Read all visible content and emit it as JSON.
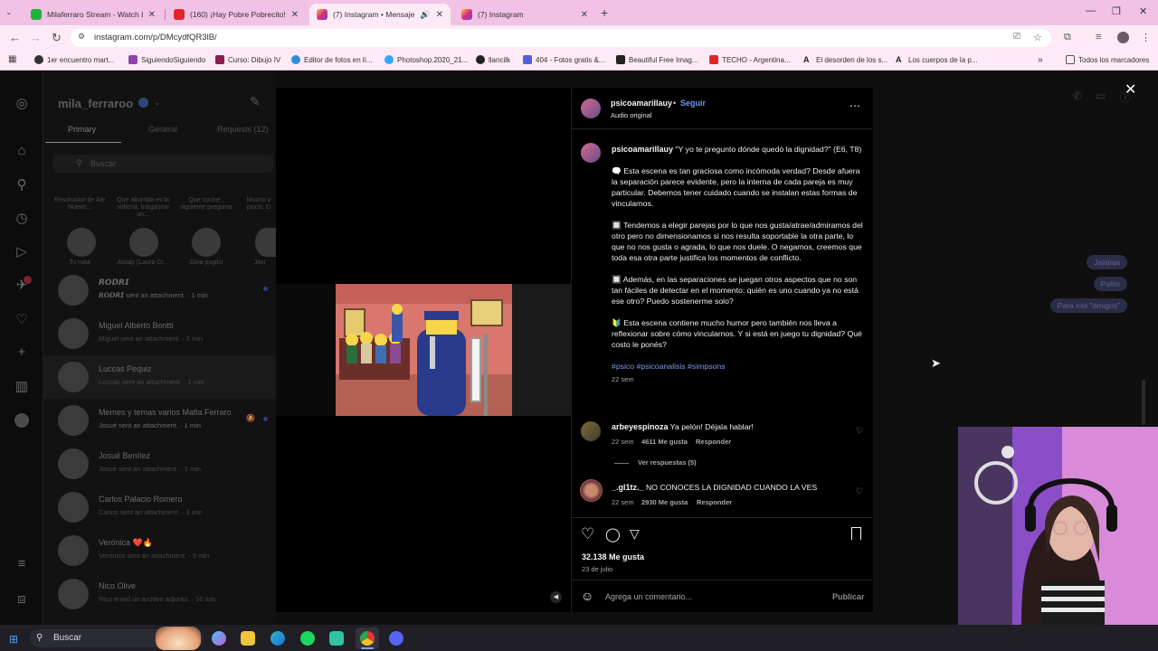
{
  "browser": {
    "tabs": [
      {
        "label": "Milaferraro Stream - Watch Liv...",
        "color": "#1fb33a"
      },
      {
        "label": "(160) ¡Hay Pobre Pobrecito!😊",
        "color": "#e3242b"
      },
      {
        "label": "(7) Instagram • Mensajes",
        "color": "#d6307b"
      },
      {
        "label": "(7) Instagram",
        "color": "#d6307b"
      }
    ],
    "url": "instagram.com/p/DMcydfQR3lB/",
    "bookmarks": [
      "1er encuentro mart...",
      "SiguiendoSiguiendo",
      "Curso: Dibujo IV",
      "Editor de fotos en lí...",
      "Photoshop.2020_21...",
      "llancilk",
      "404 - Fotos gratis &...",
      "Beautiful Free Imag...",
      "TECHO - Argentina...",
      "El desorden de los s...",
      "Los cuerpos de la p..."
    ],
    "all_bookmarks": "Todos los marcadores"
  },
  "dm": {
    "username": "mila_ferraroo",
    "tabs": [
      "Primary",
      "General",
      "Requests (12)"
    ],
    "search_placeholder": "Buscar",
    "stories": [
      {
        "note": "Resolucion de Ale Nuevo...",
        "label": "Tu nota"
      },
      {
        "note": "Que aburrida es la soltería, tráiganme un...",
        "label": "Assay (Laura Cr..."
      },
      {
        "note": "Que cocine , siguiente pregunta",
        "label": "Gina puglisi"
      },
      {
        "note": "Mucho v piscis. D",
        "label": "Javi"
      }
    ],
    "conversations": [
      {
        "name": "𝙍𝙊𝘿𝙍𝙄",
        "sub": "𝙍𝙊𝘿𝙍𝙄 sent an attachment. · 1 min"
      },
      {
        "name": "Miguel Alberto Bontti",
        "sub": "Miguel sent an attachment. · 1 min"
      },
      {
        "name": "Luccas Pequiz",
        "sub": "Luccas sent an attachment. · 1 min"
      },
      {
        "name": "Memes y temas varios Mafia Ferraro",
        "sub": "Josué sent an attachment. · 1 min"
      },
      {
        "name": "Josué Benítez",
        "sub": "Josué sent an attachment. · 1 min"
      },
      {
        "name": "Carlos Palacio Romero",
        "sub": "Carlos sent an attachment. · 3 min"
      },
      {
        "name": "Verónica ❤️🔥",
        "sub": "Verónica sent an attachment. · 9 min"
      },
      {
        "name": "Nico Olive",
        "sub": "Nico envió un archivo adjunto. · 10 min"
      }
    ],
    "bubbles": [
      "Jajajaja",
      "Palito",
      "Para mis \"amigos\""
    ]
  },
  "post": {
    "author": "psicoamarillauy",
    "follow": "Seguir",
    "audio": "Audio original",
    "caption_head": "\"Y yo te pregunto dónde quedó la dignidad?\" (E6, T8)",
    "caption_paragraphs": [
      "🗨️ Esta escena es tan graciosa como incómoda verdad? Desde afuera la separación parece evidente, pero la interna de cada pareja es muy particular. Debemos tener cuidado cuando se instalan estas formas de vincularnos.",
      "🔲 Tendemos a elegir parejas por lo que nos gusta/atrae/admiramos del otro pero no dimensionamos si nos resulta soportable la otra parte, lo que no nos gusta o agrada, lo que nos duele. O negamos, creemos que toda esa otra parte justifica los momentos de conflicto.",
      "🔲 Además, en las separaciones se juegan otros aspectos que no son tan fáciles de detectar en el momento: quién es uno cuando ya no está ese otro? Puedo sostenerme solo?",
      "🔰 Esta escena contiene mucho humor pero también nos lleva a reflexionar sobre cómo vincularnos. Y si está en juego tu dignidad? Qué costo le ponés?"
    ],
    "hashtags": "#psico #psicoanalisis #simpsons",
    "caption_age": "22 sem",
    "comments": [
      {
        "user": "arbeyespinoza",
        "text": "Ya pelón! Déjala hablar!",
        "age": "22 sem",
        "likes": "4611 Me gusta",
        "reply": "Responder",
        "view_replies": "Ver respuestas (5)"
      },
      {
        "user": "_.gl1tz._",
        "text": "NO CONOCES LA DIGNIDAD CUANDO LA VES",
        "age": "22 sem",
        "likes": "2930 Me gusta",
        "reply": "Responder"
      }
    ],
    "like_count": "32.138 Me gusta",
    "date": "23 de julio",
    "comment_placeholder": "Agrega un comentario...",
    "publish": "Publicar"
  },
  "taskbar": {
    "search": "Buscar"
  }
}
